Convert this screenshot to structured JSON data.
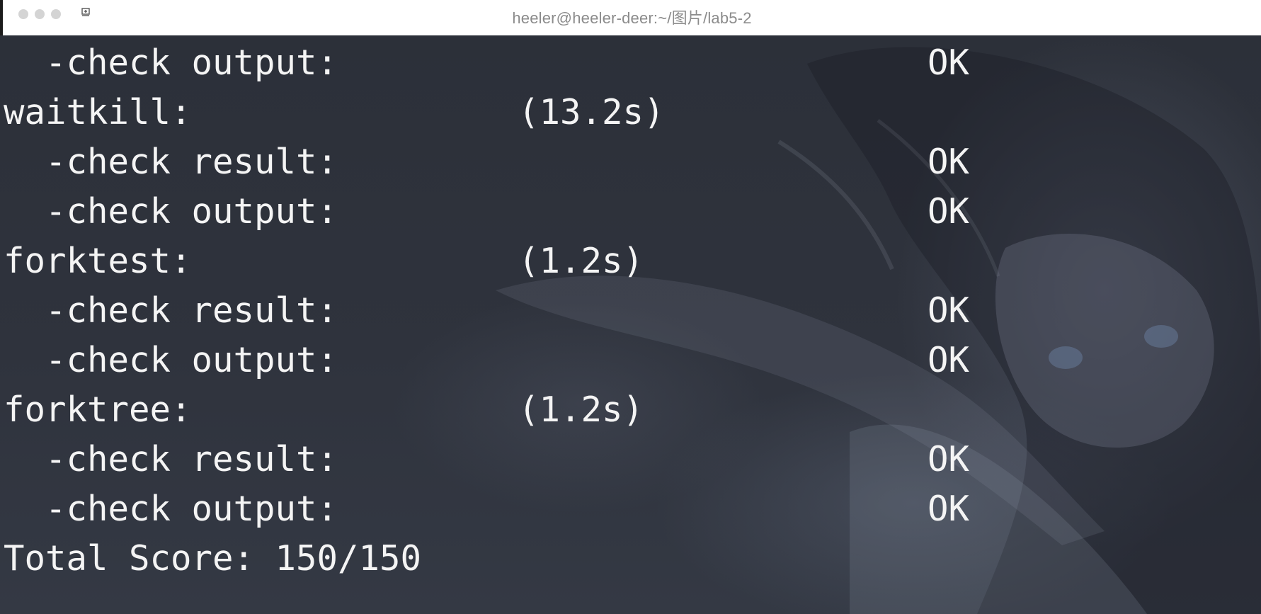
{
  "window": {
    "title": "heeler@heeler-deer:~/图片/lab5-2"
  },
  "terminal": {
    "lines": [
      {
        "name": "  -check output:",
        "time": "",
        "status": "OK"
      },
      {
        "name": "waitkill:",
        "time": "(13.2s)",
        "status": ""
      },
      {
        "name": "  -check result:",
        "time": "",
        "status": "OK"
      },
      {
        "name": "  -check output:",
        "time": "",
        "status": "OK"
      },
      {
        "name": "forktest:",
        "time": "(1.2s)",
        "status": ""
      },
      {
        "name": "  -check result:",
        "time": "",
        "status": "OK"
      },
      {
        "name": "  -check output:",
        "time": "",
        "status": "OK"
      },
      {
        "name": "forktree:",
        "time": "(1.2s)",
        "status": ""
      },
      {
        "name": "  -check result:",
        "time": "",
        "status": "OK"
      },
      {
        "name": "  -check output:",
        "time": "",
        "status": "OK"
      },
      {
        "name": "Total Score: 150/150",
        "time": "",
        "status": ""
      }
    ]
  },
  "icons": {
    "window_controls": [
      "close-dot-icon",
      "minimize-dot-icon",
      "maximize-dot-icon"
    ],
    "pin": "pin-icon"
  },
  "colors": {
    "titlebar_bg": "#ffffff",
    "title_text": "#8b8b8b",
    "terminal_bg": "#2f333d",
    "terminal_text": "#f4f4f4"
  }
}
